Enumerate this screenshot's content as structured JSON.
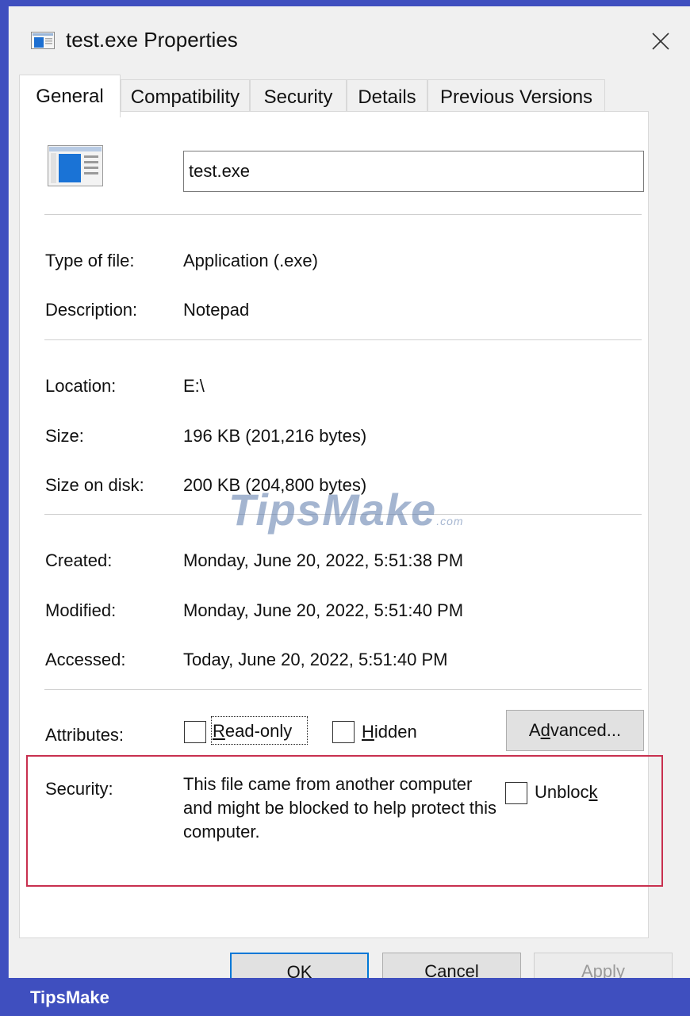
{
  "window": {
    "title": "test.exe Properties",
    "close_icon": "close-icon"
  },
  "tabs": [
    {
      "label": "General",
      "active": true
    },
    {
      "label": "Compatibility"
    },
    {
      "label": "Security"
    },
    {
      "label": "Details"
    },
    {
      "label": "Previous Versions"
    }
  ],
  "general": {
    "file_name": "test.exe",
    "type_label": "Type of file:",
    "type_value": "Application (.exe)",
    "desc_label": "Description:",
    "desc_value": "Notepad",
    "location_label": "Location:",
    "location_value": "E:\\",
    "size_label": "Size:",
    "size_value": "196 KB (201,216 bytes)",
    "size_disk_label": "Size on disk:",
    "size_disk_value": "200 KB (204,800 bytes)",
    "created_label": "Created:",
    "created_value": "Monday, June 20, 2022, 5:51:38 PM",
    "modified_label": "Modified:",
    "modified_value": "Monday, June 20, 2022, 5:51:40 PM",
    "accessed_label": "Accessed:",
    "accessed_value": "Today, June 20, 2022, 5:51:40 PM",
    "attributes_label": "Attributes:",
    "readonly": {
      "pre": "",
      "key": "R",
      "post": "ead-only",
      "checked": false
    },
    "hidden": {
      "pre": "",
      "key": "H",
      "post": "idden",
      "checked": false
    },
    "advanced": {
      "pre": "A",
      "key": "d",
      "post": "vanced..."
    },
    "security_label": "Security:",
    "security_text": "This file came from another computer and might be blocked to help protect this computer.",
    "unblock": {
      "pre": "Unbloc",
      "key": "k",
      "post": "",
      "checked": false
    }
  },
  "buttons": {
    "ok": "OK",
    "cancel": "Cancel",
    "apply": "Apply"
  },
  "watermark": {
    "main": "TipsMake",
    "suffix": ".com"
  },
  "footer": {
    "brand": "TipsMake"
  },
  "colors": {
    "accent": "#0078d7",
    "highlight_border": "#c8304f",
    "frame": "#3f4fbf"
  }
}
